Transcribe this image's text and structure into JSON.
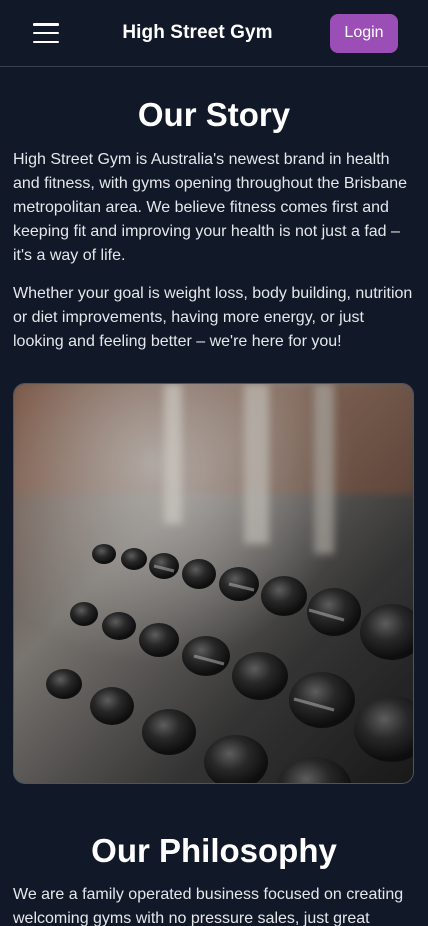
{
  "header": {
    "brand": "High Street Gym",
    "login_label": "Login",
    "menu_icon": "hamburger-menu-icon"
  },
  "story": {
    "title": "Our Story",
    "paragraph_1": "High Street Gym is Australia's newest brand in health and fitness, with gyms opening throughout the Brisbane metropolitan area. We believe fitness comes first and keeping fit and improving your health is not just a fad – it's a way of life.",
    "paragraph_2": "Whether your goal is weight loss, body building, nutrition or diet improvements, having more energy, or just looking and feeling better – we're here for you!",
    "image": "dumbbell-rack-photo"
  },
  "philosophy": {
    "title": "Our Philosophy",
    "paragraph_1": "We are a family operated business focused on creating welcoming gyms with no pressure sales, just great"
  },
  "colors": {
    "background": "#111827",
    "accent": "#9b4fb6"
  }
}
